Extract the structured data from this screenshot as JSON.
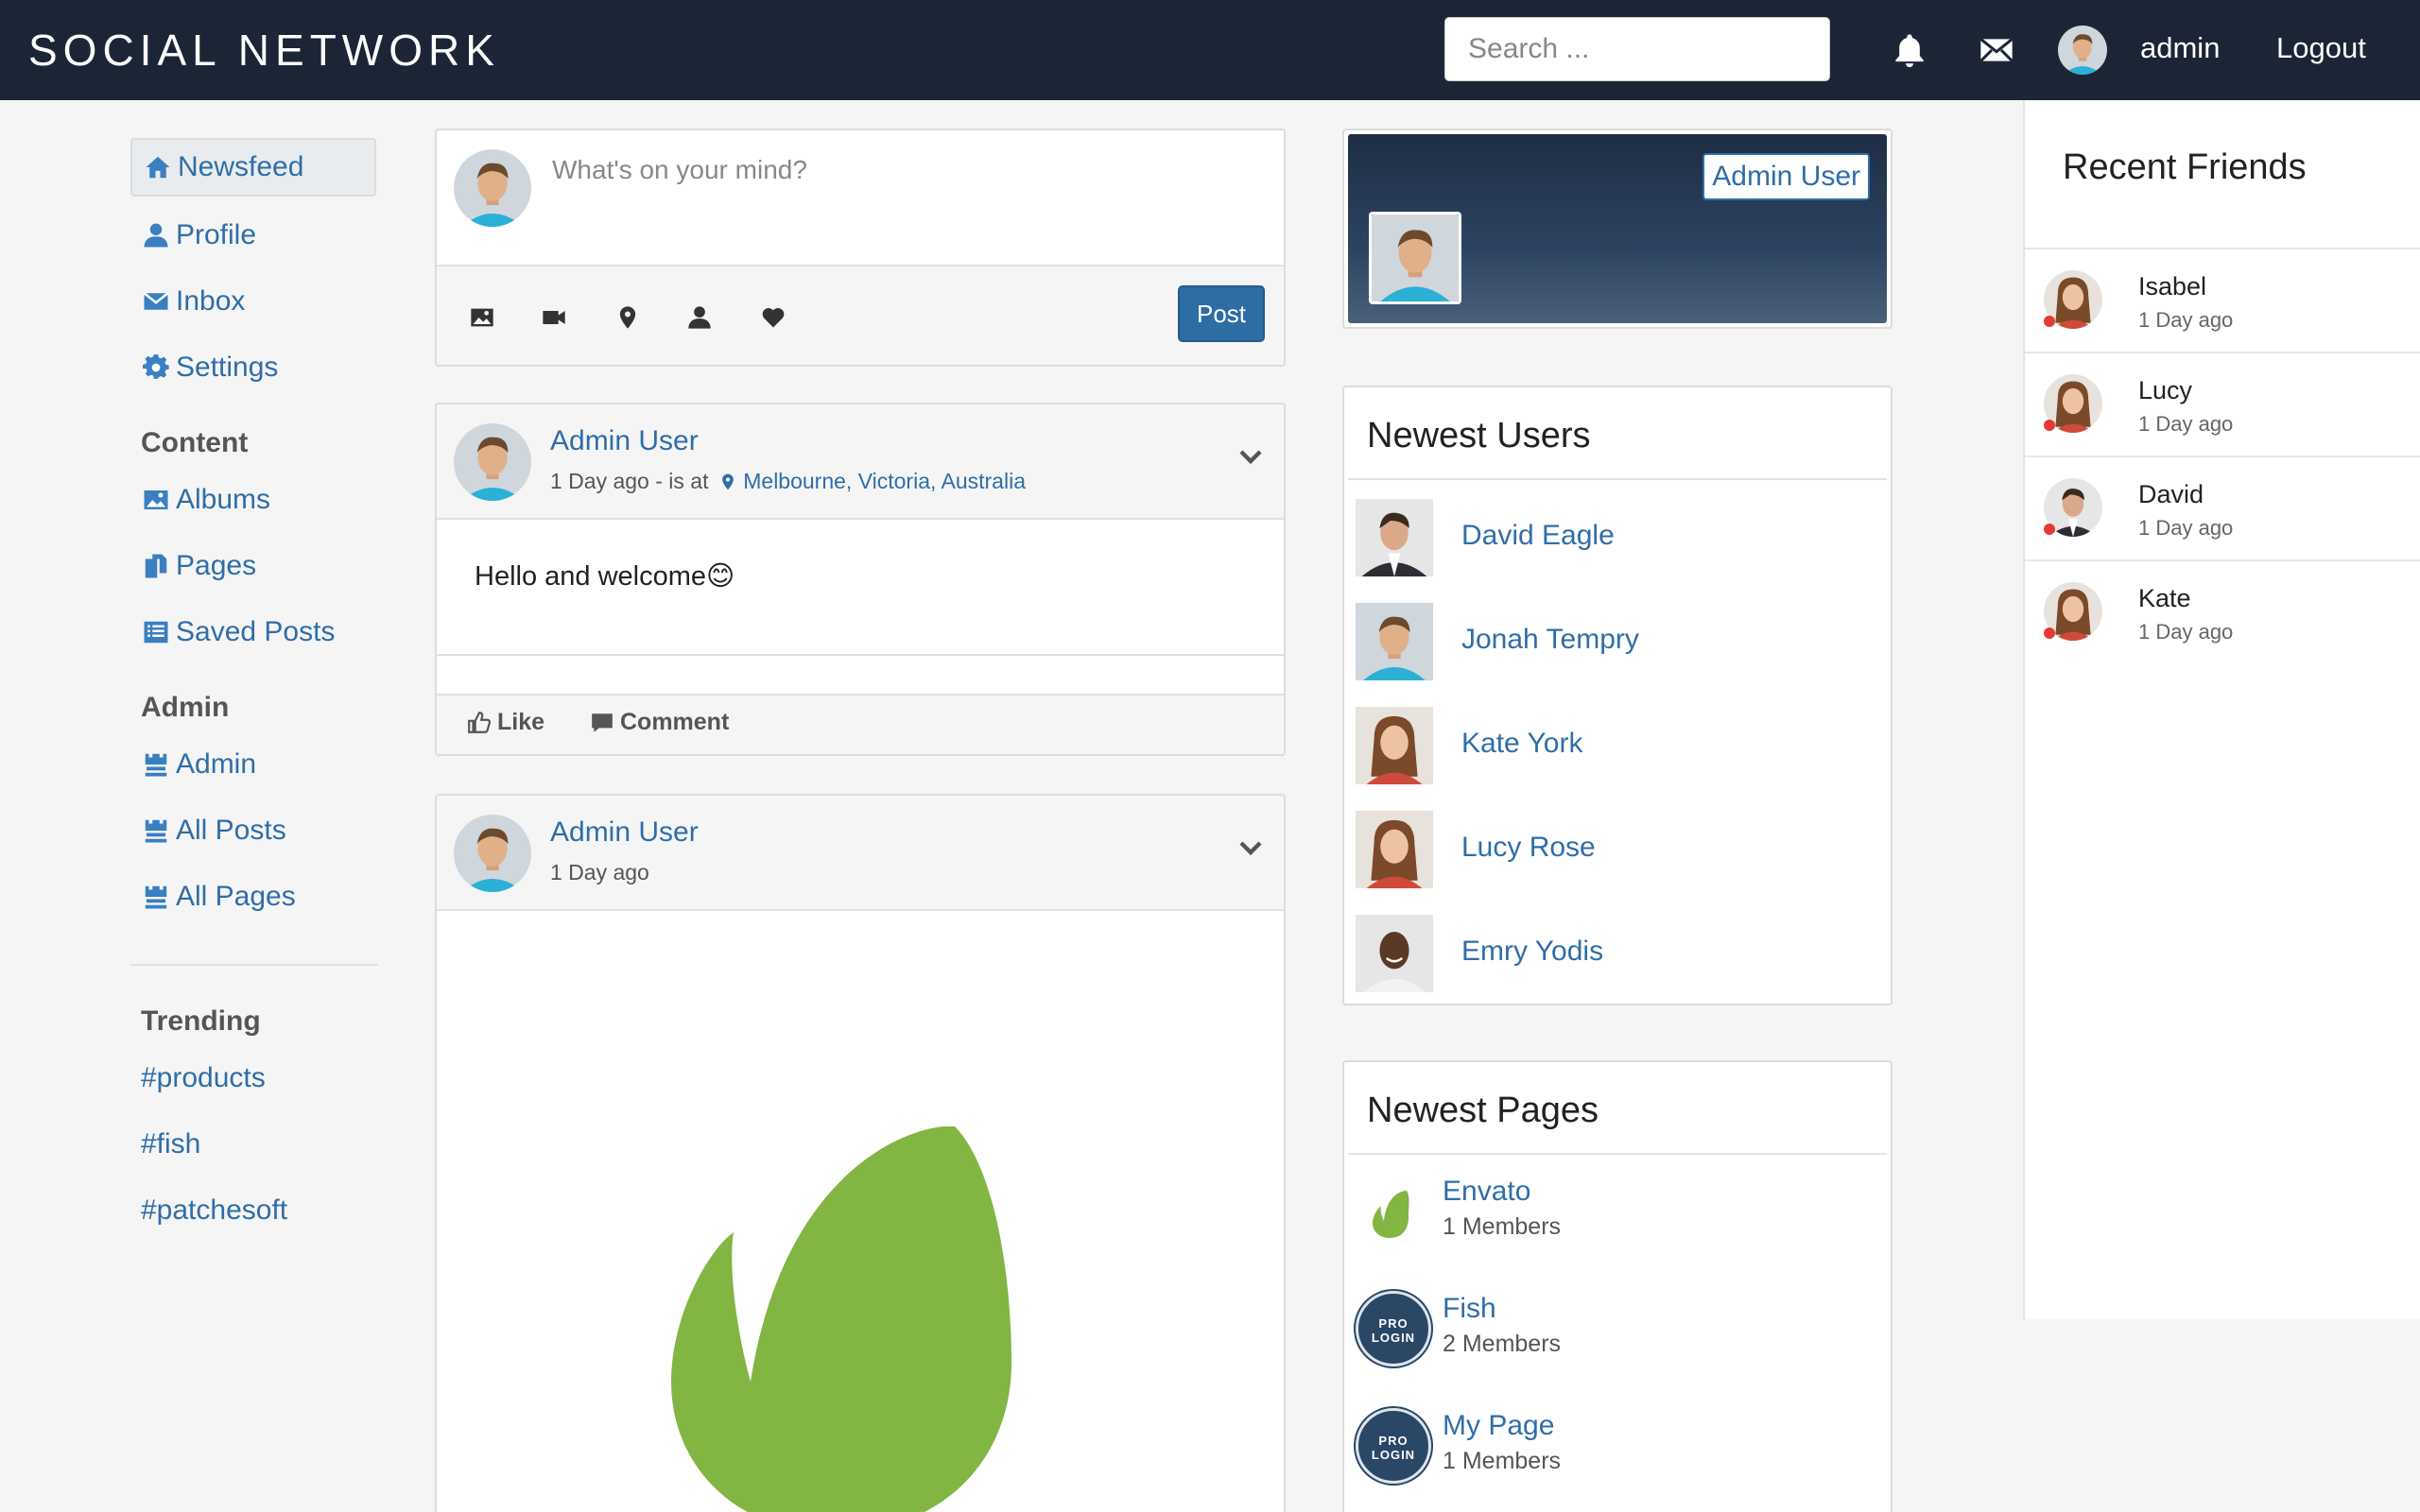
{
  "header": {
    "brand": "SOCIAL NETWORK",
    "search_placeholder": "Search ...",
    "icons": [
      "bell-icon",
      "envelope-icon"
    ],
    "user": "admin",
    "logout": "Logout"
  },
  "sidebar": {
    "main": [
      {
        "label": "Newsfeed",
        "icon": "home-icon"
      },
      {
        "label": "Profile",
        "icon": "user-icon"
      },
      {
        "label": "Inbox",
        "icon": "envelope-icon"
      },
      {
        "label": "Settings",
        "icon": "gear-icon"
      }
    ],
    "content_heading": "Content",
    "content": [
      {
        "label": "Albums",
        "icon": "picture-icon"
      },
      {
        "label": "Pages",
        "icon": "files-icon"
      },
      {
        "label": "Saved Posts",
        "icon": "list-icon"
      }
    ],
    "admin_heading": "Admin",
    "admin": [
      {
        "label": "Admin",
        "icon": "tower-icon"
      },
      {
        "label": "All Posts",
        "icon": "tower-icon"
      },
      {
        "label": "All Pages",
        "icon": "tower-icon"
      }
    ],
    "trending_heading": "Trending",
    "trending": [
      "#products",
      "#fish",
      "#patchesoft"
    ]
  },
  "composer": {
    "placeholder": "What's on your mind?",
    "tools": [
      "image-icon",
      "video-icon",
      "map-marker-icon",
      "user-tag-icon",
      "heart-icon"
    ],
    "post_label": "Post"
  },
  "posts": [
    {
      "author": "Admin User",
      "time": "1 Day ago - is at",
      "location": "Melbourne, Victoria, Australia",
      "body": "Hello and welcome😊",
      "like_label": "Like",
      "comment_label": "Comment"
    },
    {
      "author": "Admin User",
      "time": "1 Day ago",
      "image": "envato-leaf-logo"
    }
  ],
  "profile_card": {
    "name": "Admin User"
  },
  "newest_users": {
    "title": "Newest Users",
    "items": [
      "David Eagle",
      "Jonah Tempry",
      "Kate York",
      "Lucy Rose",
      "Emry Yodis"
    ]
  },
  "newest_pages": {
    "title": "Newest Pages",
    "items": [
      {
        "name": "Envato",
        "members": "1 Members",
        "logo_text": ""
      },
      {
        "name": "Fish",
        "members": "2 Members",
        "logo_text": "PRO LOGIN"
      },
      {
        "name": "My Page",
        "members": "1 Members",
        "logo_text": "PRO LOGIN"
      }
    ]
  },
  "recent_friends": {
    "title": "Recent Friends",
    "items": [
      {
        "name": "Isabel",
        "time": "1 Day ago",
        "status": "offline"
      },
      {
        "name": "Lucy",
        "time": "1 Day ago",
        "status": "offline"
      },
      {
        "name": "David",
        "time": "1 Day ago",
        "status": "offline"
      },
      {
        "name": "Kate",
        "time": "1 Day ago",
        "status": "offline"
      }
    ]
  },
  "colors": {
    "navbar": "#1b2535",
    "link": "#2f6ea8",
    "primary_button": "#2e6da4",
    "envato_green": "#82b541",
    "status_offline": "#e53935"
  }
}
